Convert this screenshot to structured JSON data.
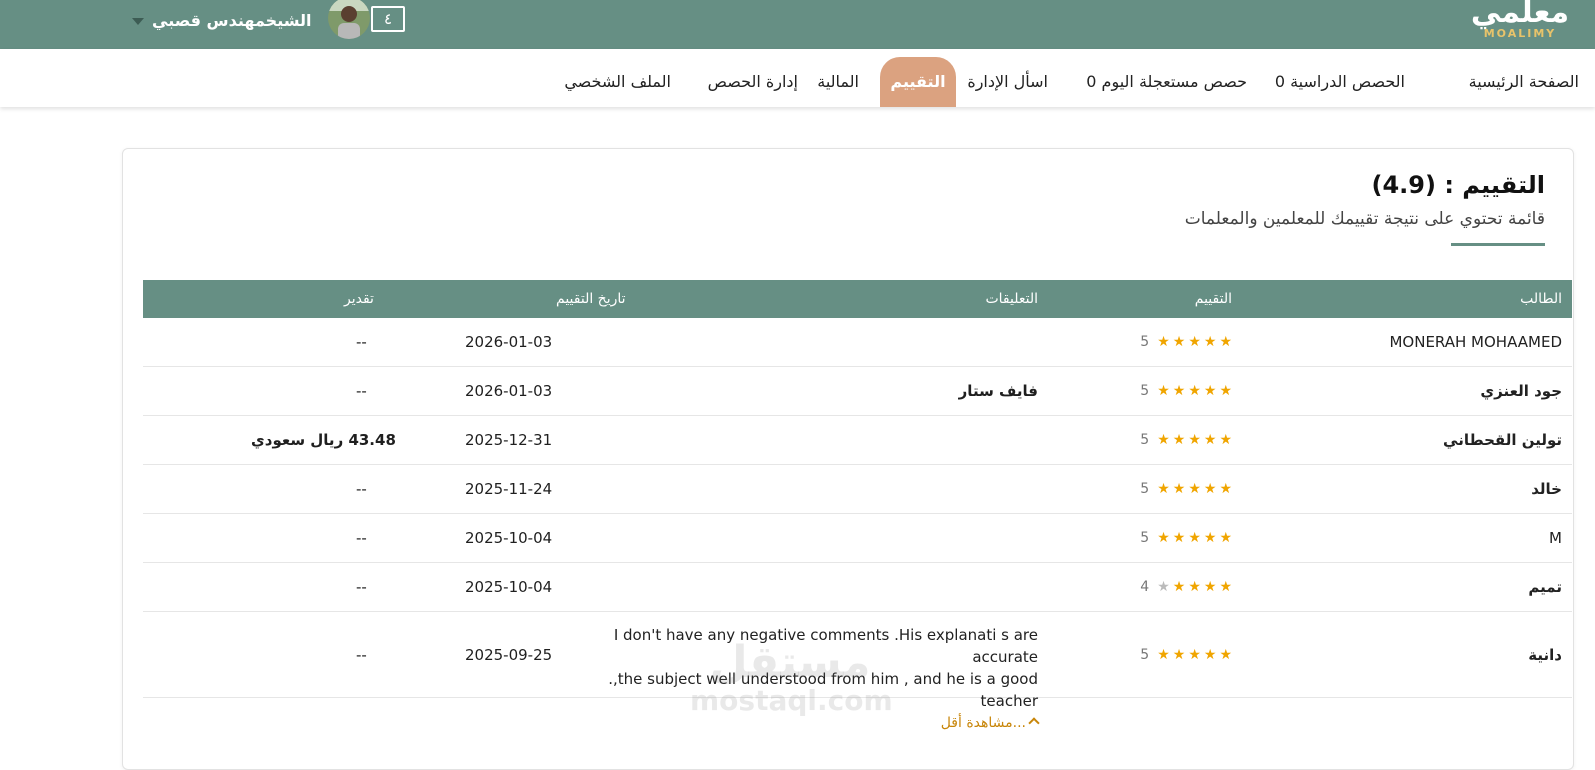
{
  "header": {
    "logo_ar": "معلمي",
    "logo_en": "MOALIMY",
    "user_name": "الشيخمهندس قصبي",
    "notification_count": "٤"
  },
  "nav": {
    "items": [
      {
        "label": "الصفحة الرئيسية"
      },
      {
        "label": "الحصص الدراسية 0"
      },
      {
        "label": "حصص مستعجلة اليوم 0"
      },
      {
        "label": "اسأل الإدارة"
      },
      {
        "label": "التقييم",
        "active": true
      },
      {
        "label": "المالية"
      },
      {
        "label": "إدارة الحصص"
      },
      {
        "label": "الملف الشخصي"
      }
    ]
  },
  "page": {
    "title": "التقييم : (4.9)",
    "subtitle": "قائمة تحتوي على نتيجة تقييمك للمعلمين والمعلمات"
  },
  "table": {
    "headers": {
      "student": "الطالب",
      "rating": "التقييم",
      "comments": "التعليقات",
      "date": "تاريخ التقييم",
      "grade": "تقدير"
    },
    "rows": [
      {
        "student": "MONERAH MOHAAMED",
        "rating": 5,
        "rating_label": "5",
        "comment": "",
        "date": "2026-01-03",
        "grade": "--"
      },
      {
        "student": "جود العنزي",
        "rating": 5,
        "rating_label": "5",
        "comment": "فايف ستار",
        "date": "2026-01-03",
        "grade": "--"
      },
      {
        "student": "تولين القحطاني",
        "rating": 5,
        "rating_label": "5",
        "comment": "",
        "date": "2025-12-31",
        "grade": "43.48 ريال سعودي"
      },
      {
        "student": "خالد",
        "rating": 5,
        "rating_label": "5",
        "comment": "",
        "date": "2025-11-24",
        "grade": "--"
      },
      {
        "student": "M",
        "rating": 5,
        "rating_label": "5",
        "comment": "",
        "date": "2025-10-04",
        "grade": "--"
      },
      {
        "student": "تميم",
        "rating": 4,
        "rating_label": "4",
        "comment": "",
        "date": "2025-10-04",
        "grade": "--"
      },
      {
        "student": "دانية",
        "rating": 5,
        "rating_label": "5",
        "comment_line1": "I don't have any negative comments .His explanati s are accurate",
        "comment_line2": ".,the subject well understood from him , and he is a good teacher",
        "show_less": "...مشاهدة أقل",
        "date": "2025-09-25",
        "grade": "--"
      }
    ]
  },
  "watermark": {
    "ar": "مستقل",
    "en": "mostaql.com"
  },
  "colors": {
    "primary": "#668f84",
    "active_tab": "#dba280",
    "star": "#f0a500",
    "show_less": "#c8860a"
  }
}
